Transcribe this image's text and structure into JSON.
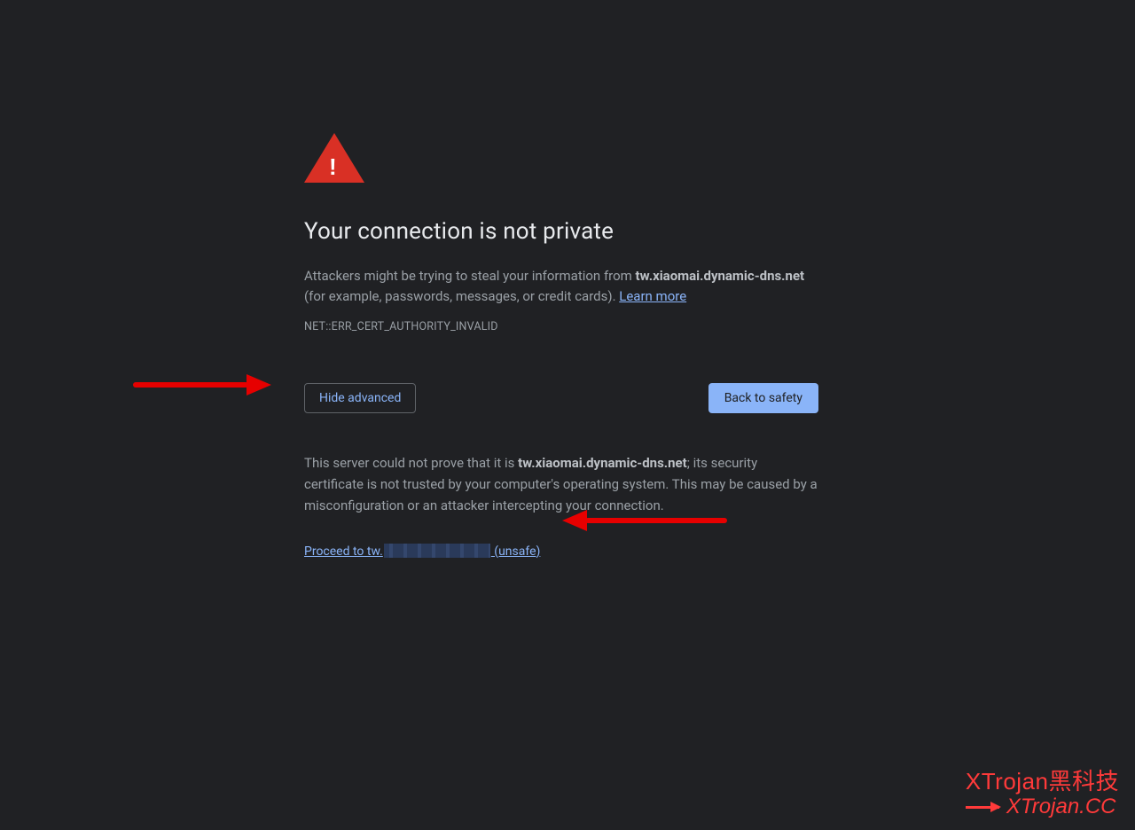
{
  "warning": {
    "title": "Your connection is not private",
    "desc_prefix": "Attackers might be trying to steal your information from ",
    "desc_domain": "tw.xiaomai.dynamic-dns.net",
    "desc_suffix": " (for example, passwords, messages, or credit cards). ",
    "learn_more": "Learn more",
    "error_code": "NET::ERR_CERT_AUTHORITY_INVALID"
  },
  "buttons": {
    "hide_advanced": "Hide advanced",
    "back_to_safety": "Back to safety"
  },
  "advanced": {
    "text_prefix": "This server could not prove that it is ",
    "text_domain": "tw.xiaomai.dynamic-dns.net",
    "text_suffix": "; its security certificate is not trusted by your computer's operating system. This may be caused by a misconfiguration or an attacker intercepting your connection."
  },
  "proceed": {
    "prefix": "Proceed to tw.",
    "suffix": " (unsafe)"
  },
  "watermark": {
    "line1": "XTrojan黑科技",
    "line2": "XTrojan.CC"
  }
}
